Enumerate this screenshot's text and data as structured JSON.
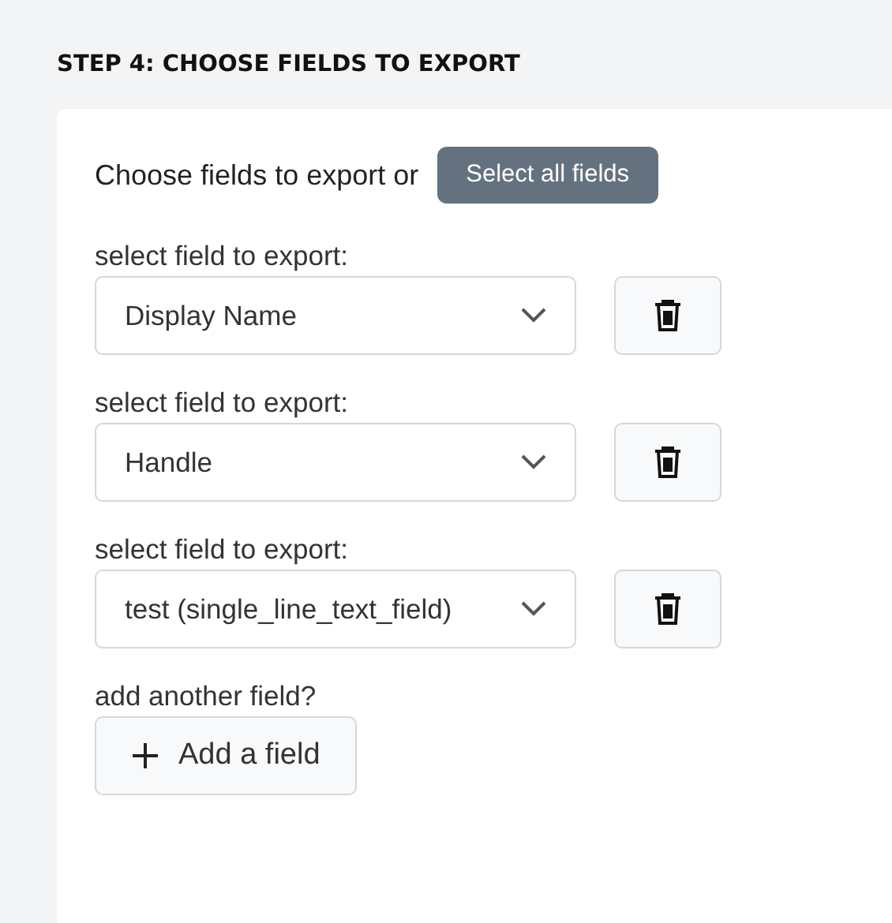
{
  "heading": "STEP 4: CHOOSE FIELDS TO EXPORT",
  "intro": {
    "text": "Choose fields to export or",
    "button": "Select all fields"
  },
  "fields": [
    {
      "label": "select field to export:",
      "value": "Display Name"
    },
    {
      "label": "select field to export:",
      "value": "Handle"
    },
    {
      "label": "select field to export:",
      "value": "test (single_line_text_field)"
    }
  ],
  "add": {
    "label": "add another field?",
    "button": "Add a field"
  }
}
